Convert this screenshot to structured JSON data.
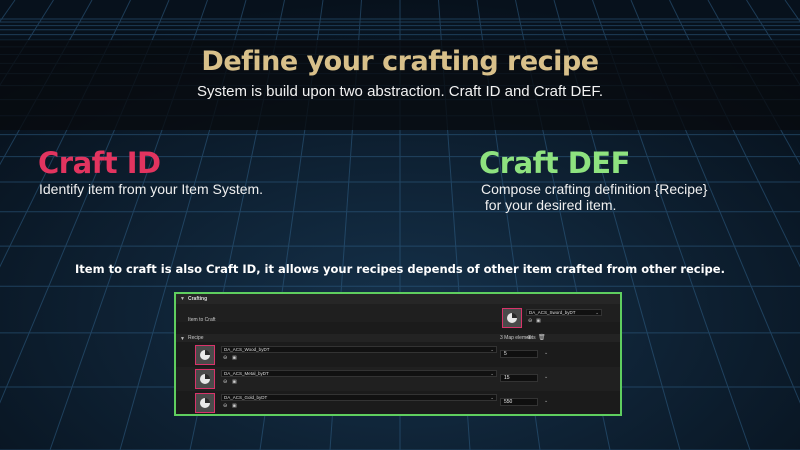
{
  "header": {
    "title": "Define your crafting recipe",
    "subtitle": "System is build upon two abstraction. Craft ID and Craft DEF."
  },
  "craft_id": {
    "heading": "Craft ID",
    "description": "Identify item from your Item System."
  },
  "craft_def": {
    "heading": "Craft DEF",
    "description_line1": "Compose crafting definition {Recipe}",
    "description_line2": " for your desired item."
  },
  "note": "Item to craft is also Craft ID, it allows your recipes depends of other item crafted from other recipe.",
  "editor": {
    "section_label": "Crafting",
    "item_to_craft_label": "Item to Craft",
    "item_to_craft_asset": "DA_ACS_Sword_byDT",
    "recipe_label": "Recipe",
    "map_elements_label": "3 Map elements",
    "rows": [
      {
        "asset": "DA_ACS_Wood_byDT",
        "quantity": "5"
      },
      {
        "asset": "DA_ACS_Metal_byDT",
        "quantity": "15"
      },
      {
        "asset": "DA_ACS_Gold_byDT",
        "quantity": "550"
      }
    ]
  },
  "colors": {
    "title": "#d8c08a",
    "craft_id": "#e2345f",
    "craft_def": "#8ee27f",
    "panel_border": "#5fce5f",
    "thumb_border": "#d8336a"
  },
  "icons": [
    "collapse-triangle-icon",
    "pie-thumbnail-icon",
    "browse-arrow-icon",
    "folder-icon",
    "chevron-down-icon",
    "add-icon",
    "trash-icon"
  ]
}
